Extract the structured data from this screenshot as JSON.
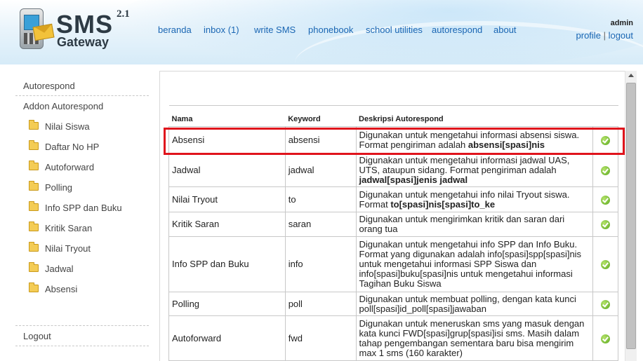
{
  "header": {
    "logo": {
      "word": "SMS",
      "subword": "Gateway",
      "version": "2.1"
    },
    "nav": [
      "beranda",
      "inbox (1)",
      "write SMS",
      "phonebook",
      "school utilities",
      "autorespond",
      "about"
    ],
    "user": {
      "name": "admin",
      "profile": "profile",
      "separator": "|",
      "logout": "logout"
    }
  },
  "sidebar": {
    "title": "Autorespond",
    "section": "Addon Autorespond",
    "items": [
      "Nilai Siswa",
      "Daftar No HP",
      "Autoforward",
      "Polling",
      "Info SPP dan Buku",
      "Kritik Saran",
      "Nilai Tryout",
      "Jadwal",
      "Absensi"
    ],
    "logout": "Logout"
  },
  "table": {
    "headers": {
      "nama": "Nama",
      "keyword": "Keyword",
      "deskripsi": "Deskripsi Autorespond"
    },
    "rows": [
      {
        "nama": "Absensi",
        "keyword": "absensi",
        "desc_parts": [
          "Digunakan untuk mengetahui informasi absensi siswa. Format pengiriman adalah ",
          "absensi[spasi]nis",
          ""
        ],
        "status_icon": "check-circle-icon",
        "highlighted": true
      },
      {
        "nama": "Jadwal",
        "keyword": "jadwal",
        "desc_parts": [
          "Digunakan untuk mengetahui informasi jadwal UAS, UTS, ataupun sidang. Format pengiriman adalah ",
          "jadwal[spasi]jenis jadwal",
          ""
        ],
        "status_icon": "check-circle-icon"
      },
      {
        "nama": "Nilai Tryout",
        "keyword": "to",
        "desc_parts": [
          "Digunakan untuk mengetahui info nilai Tryout siswa. Format ",
          "to[spasi]nis[spasi]to_ke",
          ""
        ],
        "status_icon": "check-circle-icon"
      },
      {
        "nama": "Kritik Saran",
        "keyword": "saran",
        "desc_parts": [
          "Digunakan untuk mengirimkan kritik dan saran dari orang tua",
          "",
          ""
        ],
        "status_icon": "check-circle-icon"
      },
      {
        "nama": "Info SPP dan Buku",
        "keyword": "info",
        "desc_parts": [
          "Digunakan untuk mengetahui info SPP dan Info Buku. Format yang digunakan adalah info[spasi]spp[spasi]nis untuk mengetahui informasi SPP Siswa dan info[spasi]buku[spasi]nis untuk mengetahui informasi Tagihan Buku Siswa",
          "",
          ""
        ],
        "status_icon": "check-circle-icon"
      },
      {
        "nama": "Polling",
        "keyword": "poll",
        "desc_parts": [
          "Digunakan untuk membuat polling, dengan kata kunci poll[spasi]id_poll[spasi]jawaban",
          "",
          ""
        ],
        "status_icon": "check-circle-icon"
      },
      {
        "nama": "Autoforward",
        "keyword": "fwd",
        "desc_parts": [
          "Digunakan untuk meneruskan sms yang masuk dengan kata kunci FWD[spasi]grup[spasi]isi sms. Masih dalam tahap pengembangan sementara baru bisa mengirim max 1 sms (160 karakter)",
          "",
          ""
        ],
        "status_icon": "check-circle-icon"
      }
    ]
  },
  "colors": {
    "link": "#1a66b3",
    "highlight": "#e0141c",
    "check": "#5aa81c"
  }
}
